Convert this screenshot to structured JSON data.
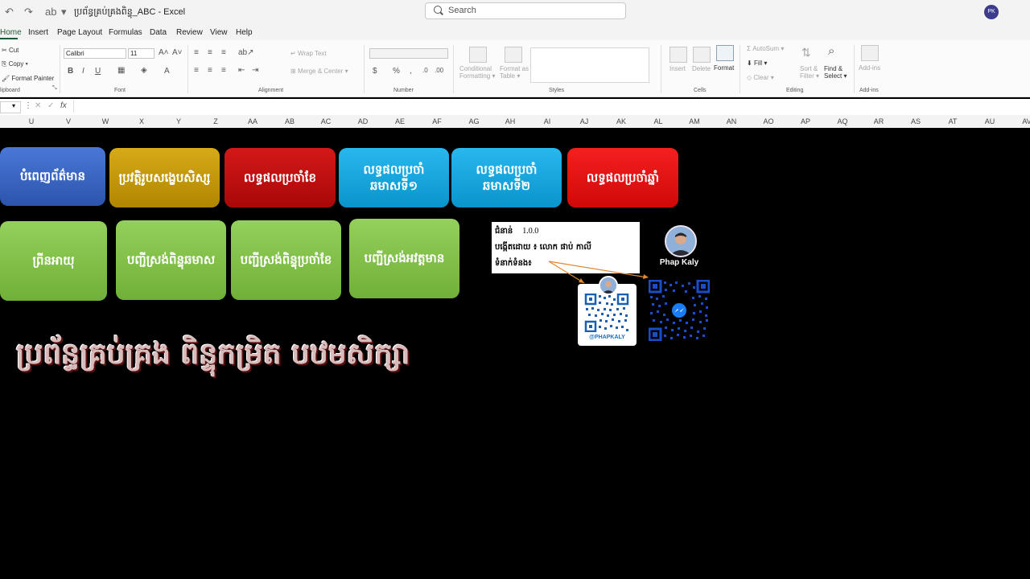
{
  "titlebar": {
    "doc_title": "ប្រព័ន្ធគ្រប់គ្រងពិន្ទុ_ABC  -  Excel",
    "search_placeholder": "Search",
    "user_initials": "PK"
  },
  "menu": [
    "Home",
    "Insert",
    "Page Layout",
    "Formulas",
    "Data",
    "Review",
    "View",
    "Help"
  ],
  "ribbon": {
    "clipboard": {
      "cut": "Cut",
      "copy": "Copy",
      "format_painter": "Format Painter",
      "label": "lipboard"
    },
    "font": {
      "family": "Calibri",
      "size": "11",
      "label": "Font"
    },
    "alignment": {
      "wrap": "Wrap Text",
      "merge": "Merge & Center",
      "label": "Alignment"
    },
    "number": {
      "format": "",
      "label": "Number"
    },
    "styles": {
      "conditional": "Conditional",
      "conditional2": "Formatting",
      "format_as": "Format as",
      "format_as2": "Table",
      "label": "Styles"
    },
    "cells": {
      "insert": "Insert",
      "delete": "Delete",
      "format": "Format",
      "label": "Cells"
    },
    "editing": {
      "autosum": "AutoSum",
      "fill": "Fill",
      "clear": "Clear",
      "sort": "Sort &",
      "sort2": "Filter",
      "find": "Find &",
      "find2": "Select",
      "label": "Editing"
    },
    "addins": {
      "addins": "Add-ins",
      "label": "Add-ins"
    }
  },
  "formula_bar": {
    "fx": "fx"
  },
  "columns": [
    "U",
    "V",
    "W",
    "X",
    "Y",
    "Z",
    "AA",
    "AB",
    "AC",
    "AD",
    "AE",
    "AF",
    "AG",
    "AH",
    "AI",
    "AJ",
    "AK",
    "AL",
    "AM",
    "AN",
    "AO",
    "AP",
    "AQ",
    "AR",
    "AS",
    "AT",
    "AU",
    "AV"
  ],
  "buttons_row1": [
    {
      "label": "បំពេញព័ត៌មាន",
      "color": "#3a66c4"
    },
    {
      "label": "ប្រវត្តិរូបសង្ខេបសិស្ស",
      "color": "#c89a08"
    },
    {
      "label": "លទ្ធផលប្រចាំខែ",
      "color": "#c20c0c"
    },
    {
      "label": "លទ្ធផលប្រចាំឆមាសទី១",
      "color": "#14a8e0"
    },
    {
      "label": "លទ្ធផលប្រចាំឆមាសទី២",
      "color": "#14a8e0"
    },
    {
      "label": "លទ្ធផលប្រចាំឆ្នាំ",
      "color": "#e80c0c"
    }
  ],
  "buttons_row2": [
    {
      "label": "ព្រីនអាយុ",
      "color": "#82c24a"
    },
    {
      "label": "បញ្ជីស្រង់ពិន្ទុឆមាស",
      "color": "#82c24a"
    },
    {
      "label": "បញ្ជីស្រង់ពិន្ទុប្រចាំខែ",
      "color": "#82c24a"
    },
    {
      "label": "បញ្ជីស្រង់អវត្តមាន",
      "color": "#82c24a"
    }
  ],
  "info": {
    "version_label": "ជំនាន់",
    "version": "1.0.0",
    "creator": "បង្កើតដោយ ៖ លោក ផាប់ កាលី",
    "contact": "ទំនាក់ទំនង៖"
  },
  "headline": "ប្រព័ន្ធគ្រប់គ្រង ពិន្ទុកម្រិត បឋមសិក្សា",
  "profile": {
    "name": "Phap Kaly",
    "qr_handle": "@PHAPKALY"
  }
}
